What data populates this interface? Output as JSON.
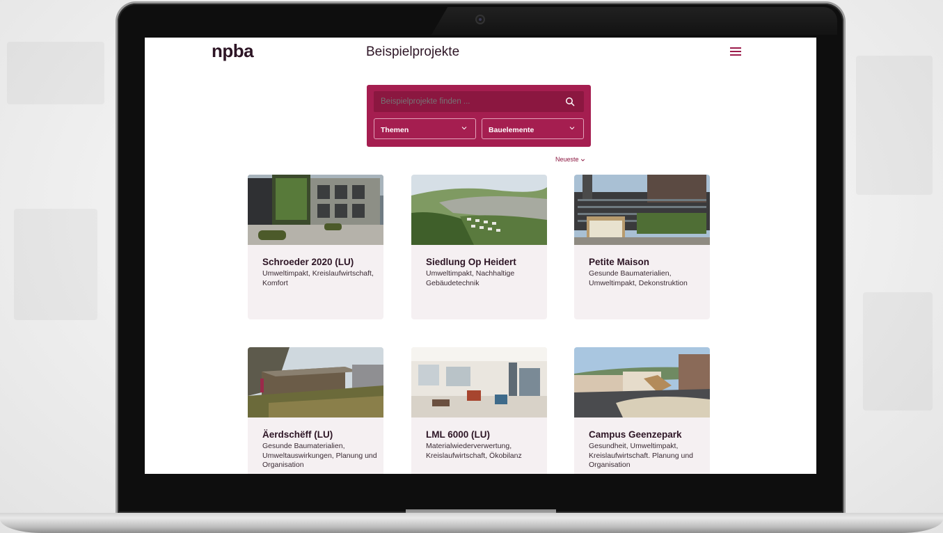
{
  "header": {
    "logo": "npba",
    "title": "Beispielprojekte"
  },
  "search": {
    "placeholder": "Beispielprojekte finden ..."
  },
  "filters": {
    "themen": "Themen",
    "bauelemente": "Bauelemente"
  },
  "sort": {
    "label": "Neueste"
  },
  "projects": [
    {
      "title": "Schroeder 2020 (LU)",
      "tags": "Umweltimpakt, Kreislaufwirtschaft, Komfort"
    },
    {
      "title": "Siedlung Op Heidert",
      "tags": "Umweltimpakt, Nachhaltige Gebäudetechnik"
    },
    {
      "title": "Petite Maison",
      "tags": "Gesunde Baumaterialien, Umweltimpakt, Dekonstruktion"
    },
    {
      "title": "Äerdschëff (LU)",
      "tags": "Gesunde Baumaterialien, Umweltauswirkungen, Planung und Organisation"
    },
    {
      "title": "LML 6000 (LU)",
      "tags": "Materialwiederverwertung, Kreislaufwirtschaft, Ökobilanz"
    },
    {
      "title": "Campus Geenzepark",
      "tags": "Gesundheit, Umweltimpakt, Kreislaufwirtschaft. Planung und Organisation"
    }
  ],
  "colors": {
    "brand": "#a51e50",
    "brand_dark": "#8b1740",
    "card_bg": "#f5f0f2"
  },
  "icons": {
    "search": "search-icon",
    "menu": "hamburger-menu-icon",
    "chevron": "chevron-down-icon"
  }
}
